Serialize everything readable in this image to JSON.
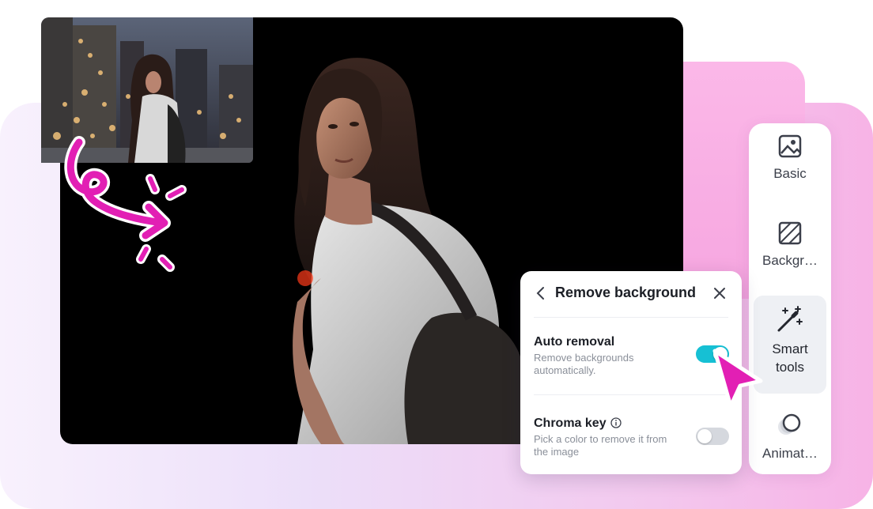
{
  "theme": {
    "accent_pink": "#e21fb4",
    "toggle_on": "#16c0d4",
    "toggle_off": "#d5d8de"
  },
  "toolbar": {
    "items": [
      {
        "label": "Basic",
        "icon": "image-icon",
        "active": false
      },
      {
        "label": "Backgr…",
        "icon": "background-hatch-icon",
        "active": false
      },
      {
        "label": "Smart tools",
        "icon": "magic-wand-icon",
        "active": true
      },
      {
        "label": "Animat…",
        "icon": "animation-circles-icon",
        "active": false
      }
    ]
  },
  "panel": {
    "title": "Remove background",
    "auto_removal": {
      "title": "Auto removal",
      "description": "Remove backgrounds automatically.",
      "enabled": true
    },
    "chroma_key": {
      "title": "Chroma key",
      "description": "Pick a color to remove it from the image",
      "enabled": false
    }
  },
  "canvas": {
    "preview": "subject-with-removed-background",
    "thumbnail": "original-photo-city-night"
  }
}
